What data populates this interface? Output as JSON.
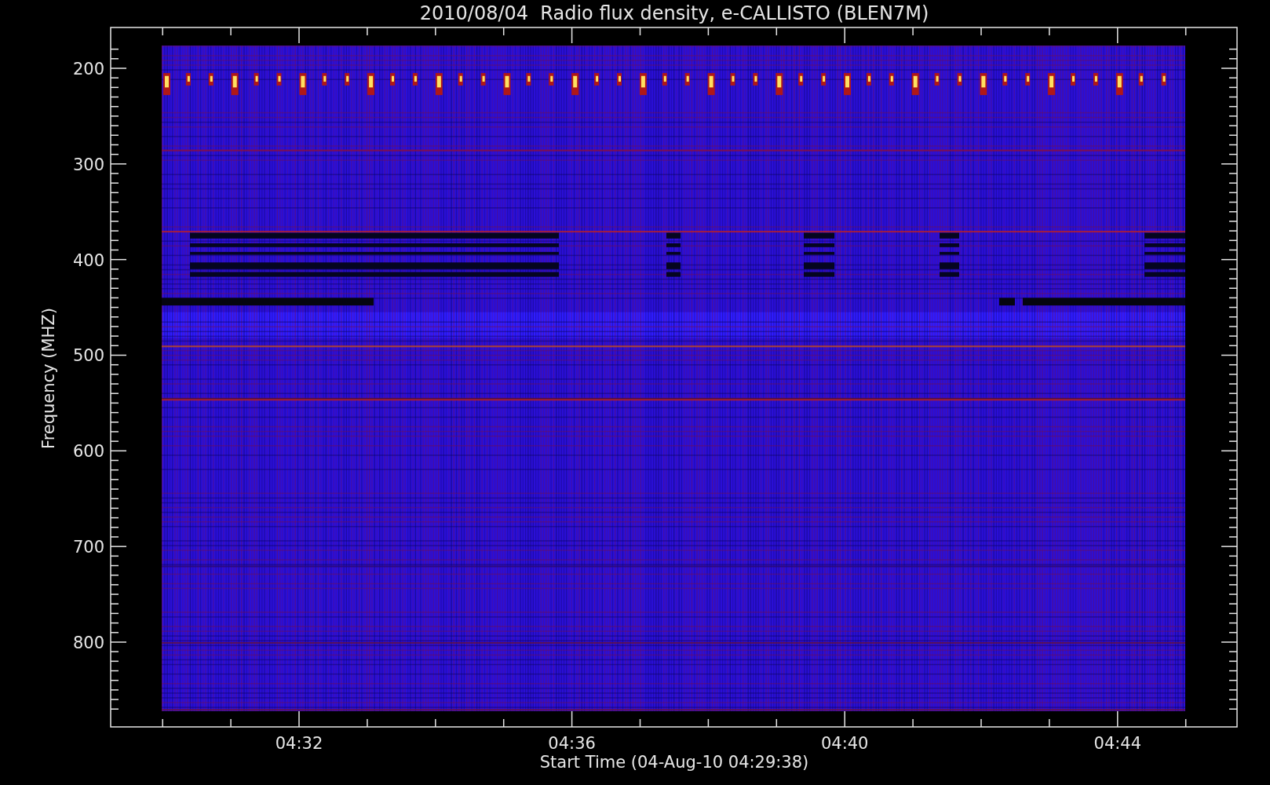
{
  "title": "2010/08/04  Radio flux density, e-CALLISTO (BLEN7M)",
  "y_axis": {
    "label": "Frequency (MHZ)",
    "ticks": [
      "200",
      "300",
      "400",
      "500",
      "600",
      "700",
      "800"
    ]
  },
  "x_axis": {
    "label": "Start Time (04-Aug-10 04:29:38)",
    "ticks": [
      "04:32",
      "04:36",
      "04:40",
      "04:44"
    ]
  }
}
